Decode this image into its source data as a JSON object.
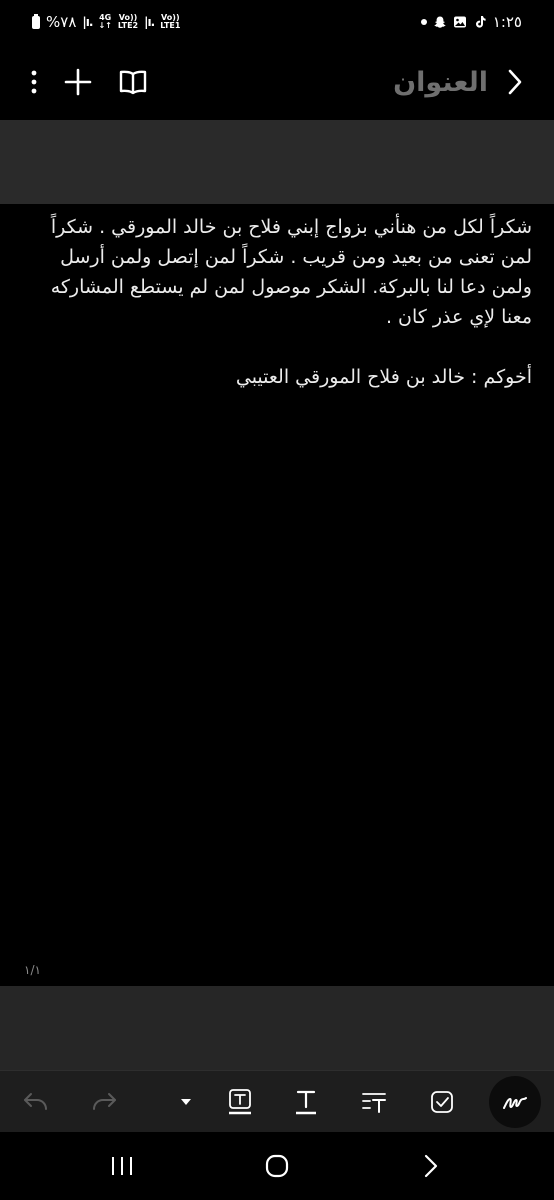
{
  "status_bar": {
    "time": "١:٢٥",
    "battery_text": "%٧٨",
    "network_1_top": "4G",
    "network_1_bottom": "↓↑",
    "network_2_top": "Vo))",
    "network_2_bottom": "LTE2",
    "network_3_top": "Vo))",
    "network_3_bottom": "LTE1",
    "signal_1": "|ı.",
    "signal_2": "|ı.",
    "icons": [
      "tiktok-icon",
      "gallery-icon",
      "snapchat-icon",
      "notification-dot"
    ]
  },
  "header": {
    "title": "العنوان",
    "back_icon": "chevron-right-icon",
    "actions": [
      "book-icon",
      "plus-icon",
      "more-vertical-icon"
    ]
  },
  "note": {
    "paragraph": "شكراً لكل من هنأني بزواج إبني فلاح بن خالد المورقي . شكراً لمن تعنى من بعيد ومن قريب . شكراً لمن إتصل ولمن أرسل ولمن دعا لنا بالبركة.  الشكر موصول لمن لم يستطع المشاركه معنا لإي عذر كان .",
    "signature": "أخوكم : خالد بن فلاح المورقي العتيبي"
  },
  "page_indicator": "١/١",
  "toolbar": {
    "items": [
      "undo-icon",
      "redo-icon",
      "dropdown-arrow-icon",
      "text-box-icon",
      "text-underline-icon",
      "text-align-icon",
      "checkbox-icon",
      "pen-icon"
    ]
  },
  "nav": {
    "items": [
      "recent-apps-icon",
      "home-icon",
      "back-icon"
    ]
  },
  "colors": {
    "background": "#000000",
    "band": "#2a2a2a",
    "toolbar": "#1e1e1e",
    "title_grey": "#6f6f6f",
    "text": "#ececec"
  }
}
